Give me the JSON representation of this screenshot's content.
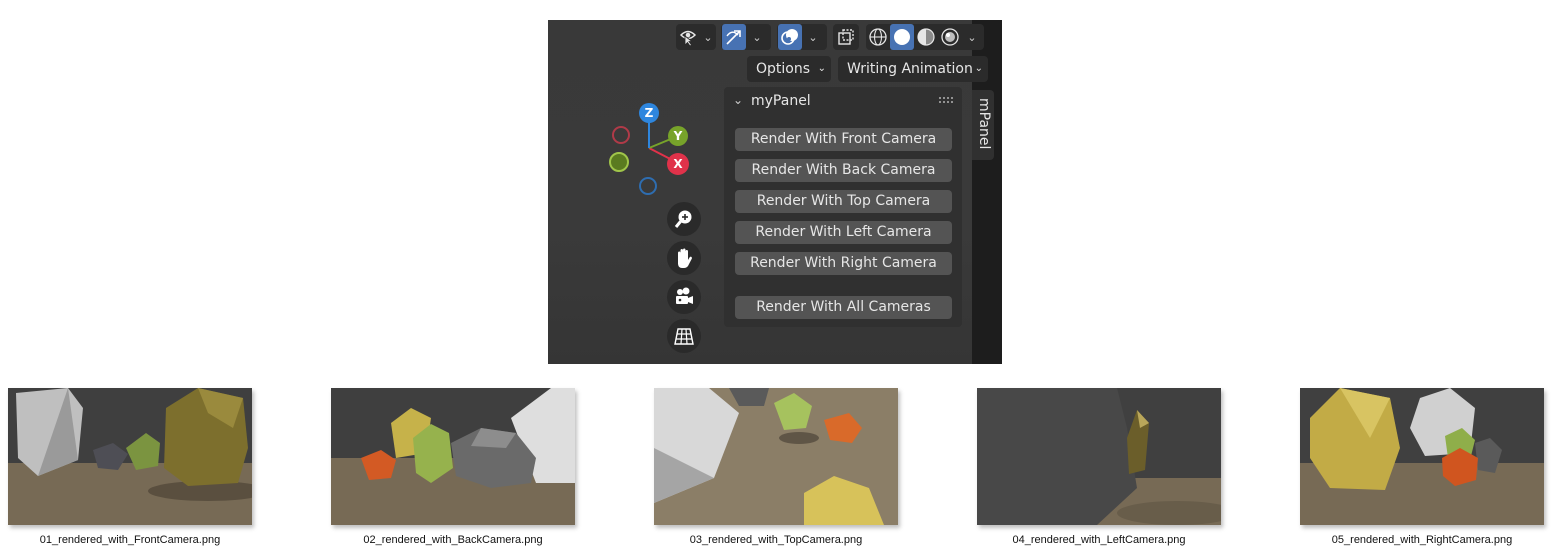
{
  "header": {
    "view_icon": "eye-cursor-icon",
    "gizmo_icon": "gizmo-arrows-icon",
    "overlay_icon": "overlays-icon",
    "xray_icon": "xray-toggle-icon",
    "shading_modes": [
      "wireframe-icon",
      "solid-icon",
      "material-preview-icon",
      "rendered-icon"
    ],
    "active_shading": "solid-icon",
    "options_label": "Options",
    "workspace_label": "Writing Animation"
  },
  "gizmo": {
    "x": "X",
    "y": "Y",
    "z": "Z",
    "colors": {
      "x": "#e0324a",
      "y": "#77a32a",
      "z": "#2e86de"
    }
  },
  "nav_buttons": [
    "zoom-icon",
    "hand-pan-icon",
    "camera-view-icon",
    "grid-ortho-icon"
  ],
  "panel": {
    "title": "myPanel",
    "tab_label": "mPanel",
    "buttons": [
      "Render With Front Camera",
      "Render With Back Camera",
      "Render With Top Camera",
      "Render With Left Camera",
      "Render With Right Camera",
      "Render With All Cameras"
    ]
  },
  "renders": [
    {
      "filename": "01_rendered_with_FrontCamera.png"
    },
    {
      "filename": "02_rendered_with_BackCamera.png"
    },
    {
      "filename": "03_rendered_with_TopCamera.png"
    },
    {
      "filename": "04_rendered_with_LeftCamera.png"
    },
    {
      "filename": "05_rendered_with_RightCamera.png"
    }
  ],
  "colors": {
    "accent": "#4772b3",
    "viewport_bg": "#3a3a3a",
    "panel_bg": "#303030",
    "button_bg": "#545454"
  }
}
